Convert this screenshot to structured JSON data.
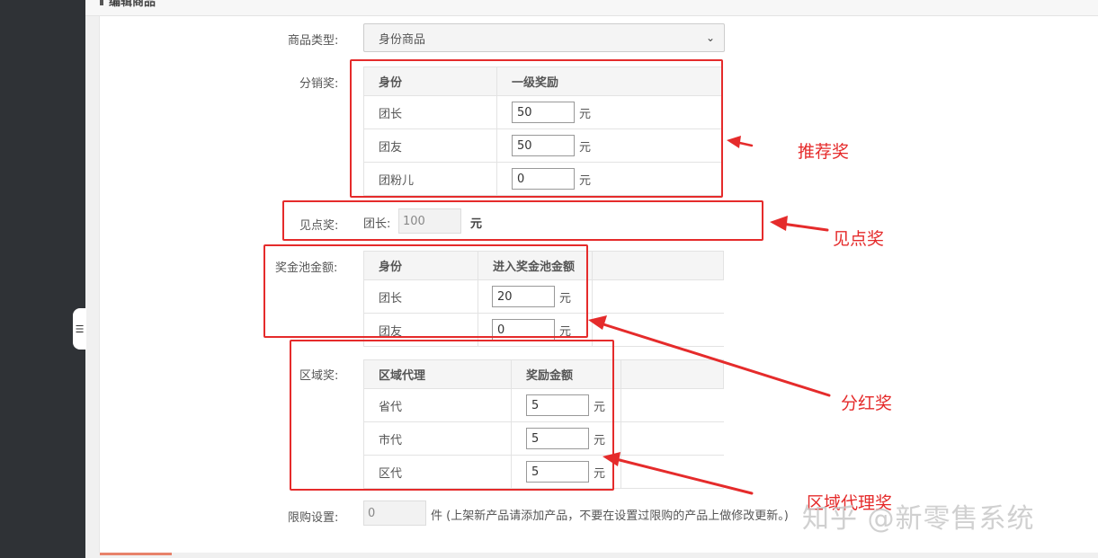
{
  "page_header": "编辑商品",
  "collapse_icon": "indent-icon",
  "product_type": {
    "label": "商品类型:",
    "value": "身份商品"
  },
  "distribution": {
    "label": "分销奖:",
    "headers": [
      "身份",
      "一级奖励"
    ],
    "rows": [
      {
        "name": "团长",
        "value": "50",
        "unit": "元"
      },
      {
        "name": "团友",
        "value": "50",
        "unit": "元"
      },
      {
        "name": "团粉儿",
        "value": "0",
        "unit": "元"
      }
    ]
  },
  "see_point": {
    "label": "见点奖:",
    "field_label": "团长:",
    "value": "100",
    "unit": "元"
  },
  "pool": {
    "label": "奖金池金额:",
    "headers": [
      "身份",
      "进入奖金池金额"
    ],
    "rows": [
      {
        "name": "团长",
        "value": "20",
        "unit": "元"
      },
      {
        "name": "团友",
        "value": "0",
        "unit": "元"
      }
    ]
  },
  "region": {
    "label": "区域奖:",
    "headers": [
      "区域代理",
      "奖励金额"
    ],
    "rows": [
      {
        "name": "省代",
        "value": "5",
        "unit": "元"
      },
      {
        "name": "市代",
        "value": "5",
        "unit": "元"
      },
      {
        "name": "区代",
        "value": "5",
        "unit": "元"
      }
    ]
  },
  "limit": {
    "label": "限购设置:",
    "value": "0",
    "note": "件 (上架新产品请添加产品，不要在设置过限购的产品上做修改更新。)"
  },
  "annotations": {
    "recommend": "推荐奖",
    "see_point": "见点奖",
    "dividend": "分红奖",
    "region_agent": "区域代理奖"
  },
  "watermark": "知乎 @新零售系统",
  "colors": {
    "annotation_red": "#e52b2b",
    "sidebar": "#2f3236"
  }
}
